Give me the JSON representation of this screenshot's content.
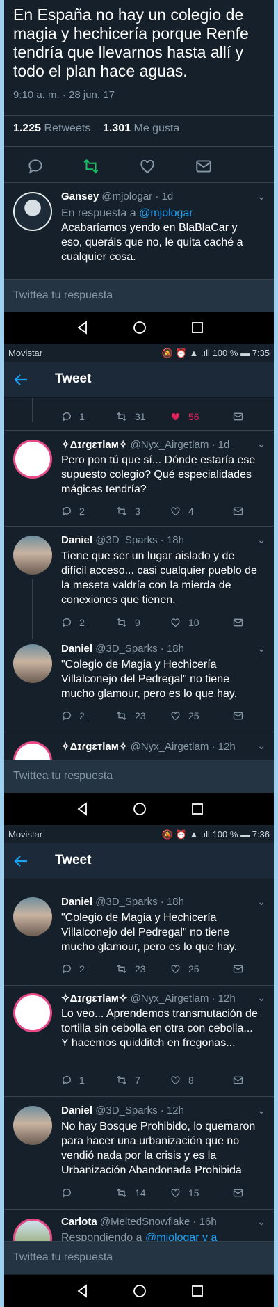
{
  "colors": {
    "background": "#15202b",
    "accent": "#1da1f2",
    "retweet": "#17bf63",
    "like": "#e0245e",
    "muted": "#8899a6"
  },
  "screen1": {
    "tweet_text": "En España no hay un colegio de magia y hechicería porque Renfe tendría que llevarnos hasta allí y todo el plan hace aguas.",
    "timestamp": "9:10 a. m. · 28 jun. 17",
    "retweets_count": "1.225",
    "retweets_label": "Retweets",
    "likes_count": "1.301",
    "likes_label": "Me gusta",
    "reply": {
      "name": "Gansey",
      "handle": "@mjologar",
      "time": "· 1d",
      "replying_prefix": "En respuesta a",
      "replying_to": "@mjologar",
      "text": "Acabaríamos yendo en BlaBlaCar y eso, queráis que no, le quita caché a cualquier cosa."
    },
    "reply_placeholder": "Twittea tu respuesta"
  },
  "screen2": {
    "status": {
      "carrier": "Movistar",
      "battery": "100 %",
      "time": "7:35"
    },
    "title": "Tweet",
    "top_actions": {
      "replies": "1",
      "retweets": "31",
      "likes": "56"
    },
    "replies": [
      {
        "name": "✧Δɪɾgɛтlaм✧",
        "handle": "@Nyx_Airgetlam",
        "time": "· 1d",
        "text": "Pero pon tú que sí... Dónde estaría ese supuesto colegio? Qué especialidades mágicas tendría?",
        "replies": "2",
        "retweets": "3",
        "likes": "4"
      },
      {
        "name": "Daniel",
        "handle": "@3D_Sparks",
        "time": "· 18h",
        "text": "Tiene que ser un lugar aislado y de difícil acceso... casi cualquier pueblo de la meseta valdría con la mierda de conexiones que tienen.",
        "replies": "2",
        "retweets": "9",
        "likes": "10"
      },
      {
        "name": "Daniel",
        "handle": "@3D_Sparks",
        "time": "· 18h",
        "text": "\"Colegio de Magia y Hechicería Villalconejo del Pedregal\" no tiene mucho glamour, pero es lo que hay.",
        "replies": "2",
        "retweets": "23",
        "likes": "25"
      },
      {
        "name": "✧Δɪɾgɛтlaм✧",
        "handle": "@Nyx_Airgetlam",
        "time": "· 12h"
      }
    ],
    "reply_placeholder": "Twittea tu respuesta"
  },
  "screen3": {
    "status": {
      "carrier": "Movistar",
      "battery": "100 %",
      "time": "7:36"
    },
    "title": "Tweet",
    "replies": [
      {
        "name": "Daniel",
        "handle": "@3D_Sparks",
        "time": "· 18h",
        "text": "\"Colegio de Magia y Hechicería Villalconejo del Pedregal\" no tiene mucho glamour, pero es lo que hay.",
        "replies": "2",
        "retweets": "23",
        "likes": "25"
      },
      {
        "name": "✧Δɪɾgɛтlaм✧",
        "handle": "@Nyx_Airgetlam",
        "time": "· 12h",
        "text": "Lo veo... Aprendemos transmutación de tortilla sin cebolla en otra con cebolla... Y hacemos quidditch en fregonas...",
        "replies": "1",
        "retweets": "7",
        "likes": "8"
      },
      {
        "name": "Daniel",
        "handle": "@3D_Sparks",
        "time": "· 12h",
        "text": "No hay Bosque Prohibido, lo quemaron para hacer una urbanización que no vendió nada por la crisis y es la Urbanización Abandonada Prohibida",
        "replies": "",
        "retweets": "14",
        "likes": "15"
      },
      {
        "name": "Carlota",
        "handle": "@MeltedSnowflake",
        "time": "· 16h",
        "replying_prefix": "Respondiendo a",
        "replying_to": "@mjologar y a"
      }
    ],
    "reply_placeholder": "Twittea tu respuesta"
  }
}
